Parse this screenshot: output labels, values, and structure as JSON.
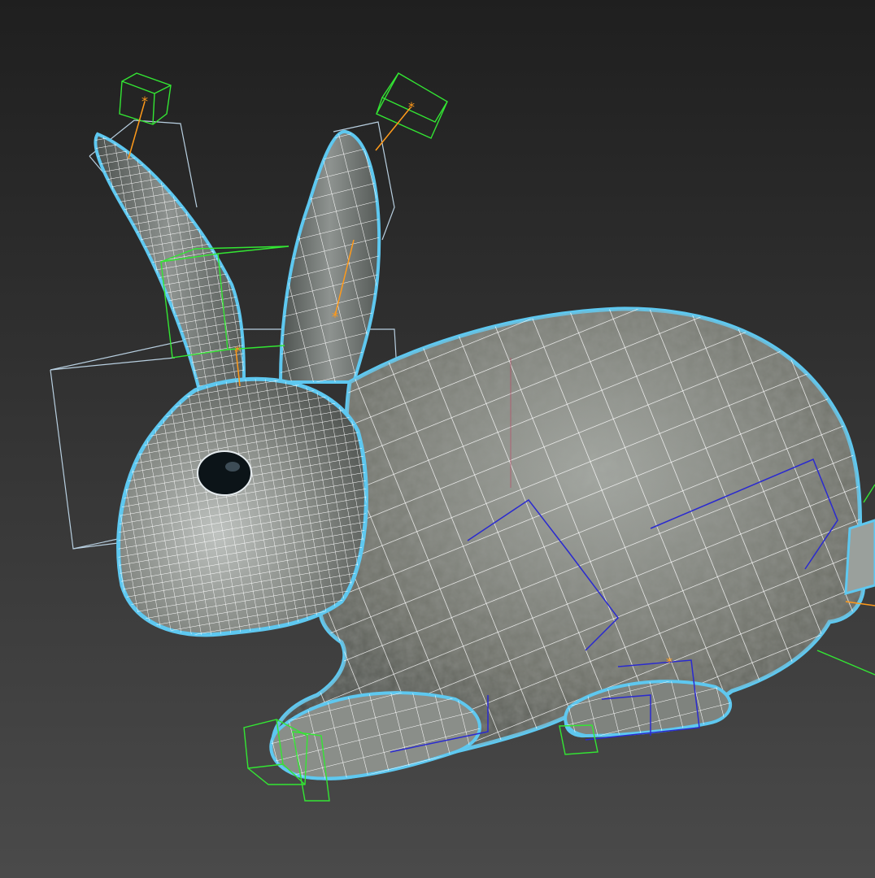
{
  "viewport": {
    "active": true,
    "colors": {
      "background_top": "#1f1f1f",
      "background_bottom": "#4a4a4a",
      "active_border": "#c9a227",
      "selection_outline": "#5ec8f0",
      "wireframe": "#ffffff",
      "rig_helper": "#33e633",
      "bone_link": "#ff9a1a",
      "bounding_box": "#b8cfe0",
      "leg_bones": "#2a2ad0",
      "fur_base": "#6e7068",
      "fur_dark": "#3a3e3c",
      "fur_light": "#a6aaa4",
      "eye": "#0c1418"
    },
    "scene": {
      "object": "rabbit-mesh",
      "display_mode": "shaded-with-wireframe",
      "selected": true
    }
  }
}
